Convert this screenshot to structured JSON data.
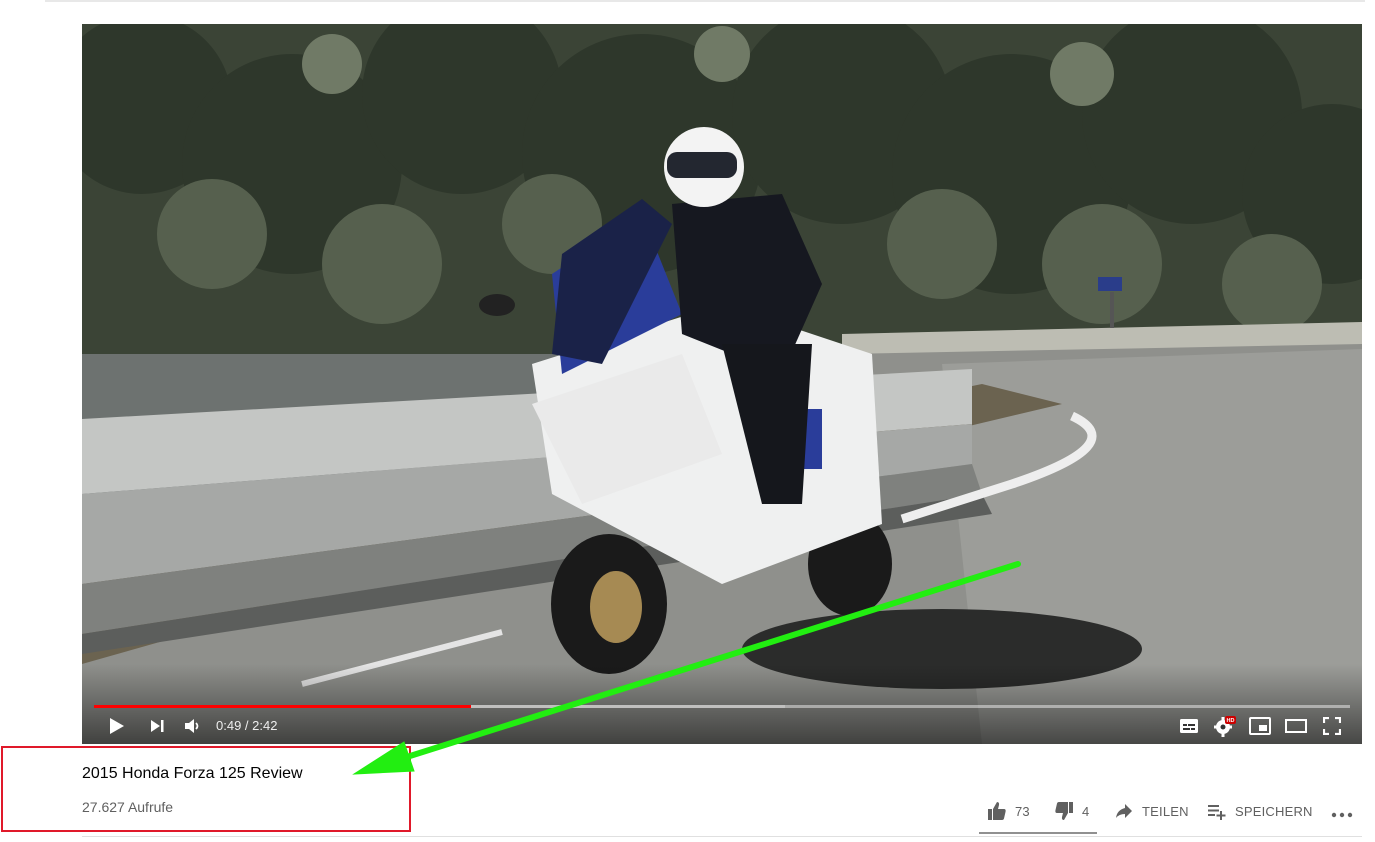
{
  "player": {
    "current_time": "0:49",
    "duration": "2:42",
    "time_separator": " / ",
    "progress_fraction": 0.3,
    "buffered_fraction": 0.55,
    "progress_color": "#ff0000",
    "hd_badge": "HD"
  },
  "video": {
    "title": "2015 Honda Forza 125 Review",
    "views": "27.627 Aufrufe"
  },
  "actions": {
    "likes": "73",
    "dislikes": "4",
    "share_label": "TEILEN",
    "save_label": "SPEICHERN"
  },
  "annotation": {
    "box_color": "#e0192a",
    "arrow_color": "#22ee11"
  }
}
